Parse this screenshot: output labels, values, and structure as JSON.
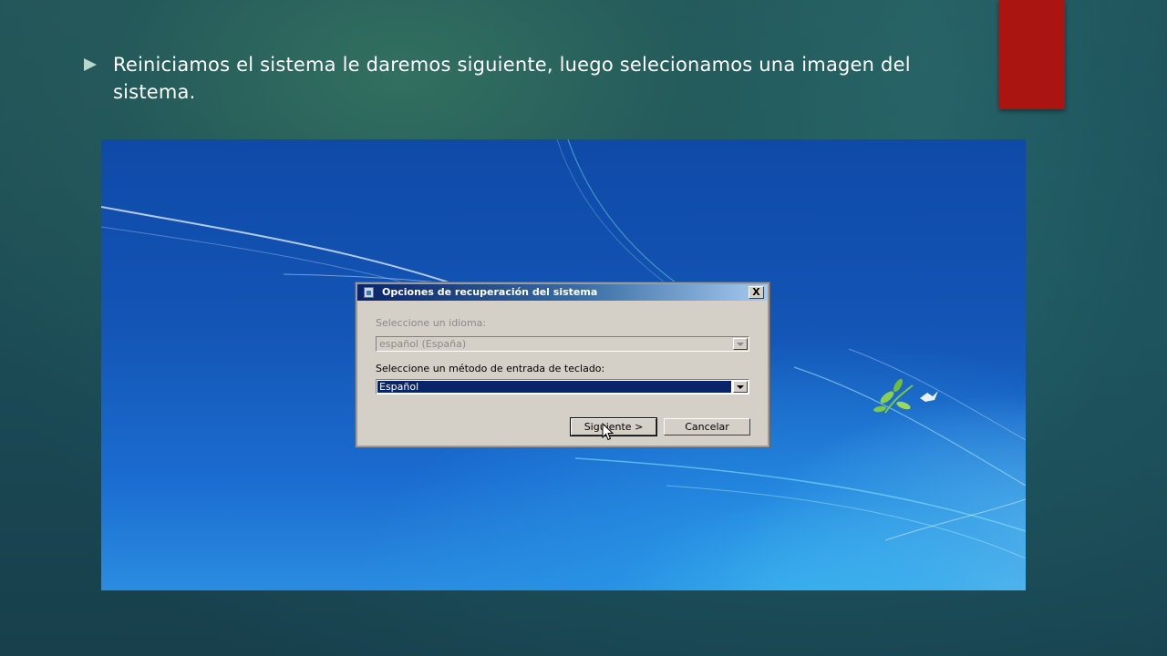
{
  "slide": {
    "bullet_text": "Reiniciamos el sistema le daremos siguiente, luego selecionamos una imagen del sistema.",
    "accent_color": "#aa1512"
  },
  "dialog": {
    "title": "Opciones de recuperación del sistema",
    "close_label": "X",
    "language_label": "Seleccione un idioma:",
    "language_value": "español (España)",
    "keyboard_label": "Seleccione un método de entrada de teclado:",
    "keyboard_value": "Español",
    "next_label": "Siguiente >",
    "cancel_label": "Cancelar"
  },
  "icons": {
    "bullet": "triangle-bullet-icon",
    "app": "system-recovery-icon",
    "close": "close-icon",
    "dropdown": "chevron-down-icon",
    "cursor": "mouse-cursor-icon"
  }
}
